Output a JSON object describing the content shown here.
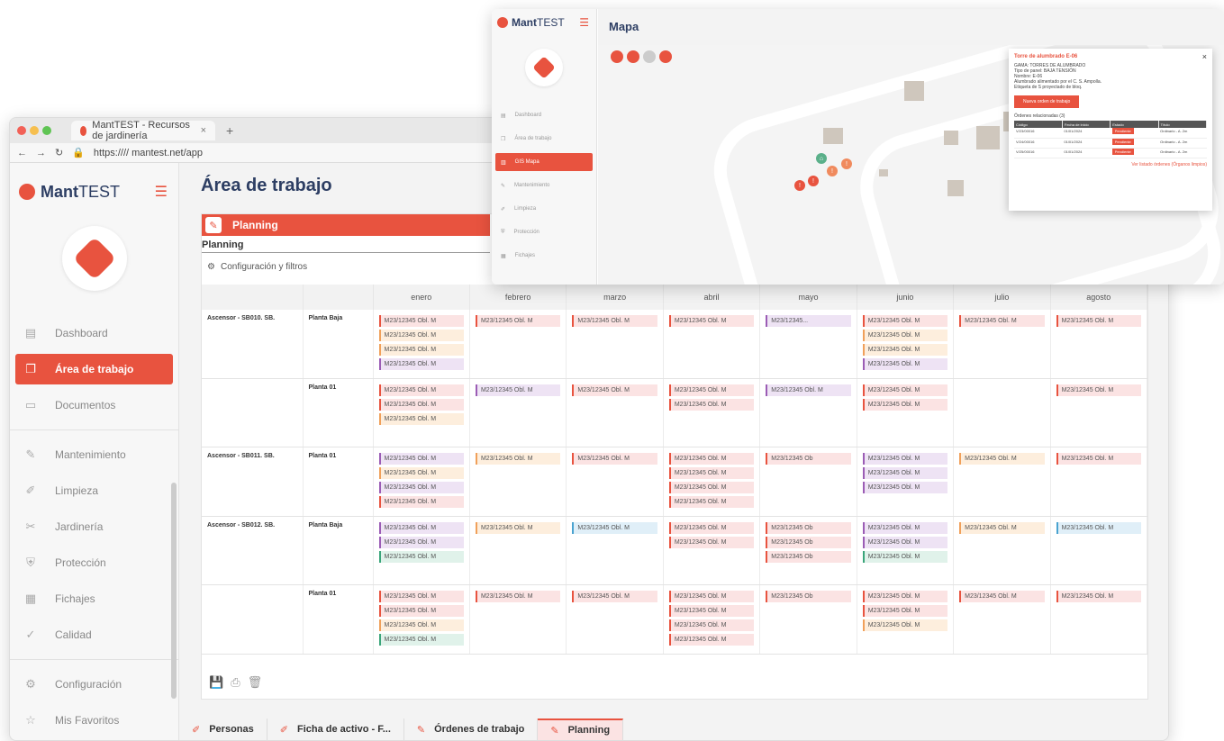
{
  "browser": {
    "tab_title": "MantTEST - Recursos de jardinería",
    "tab_close": "×",
    "new_tab": "+",
    "url": "https://// mantest.net/app"
  },
  "app": {
    "brand_prefix": "Mant",
    "brand_suffix": "TEST",
    "page_title": "Área de trabajo",
    "nav": [
      {
        "label": "Dashboard",
        "icon": "dashboard-icon"
      },
      {
        "label": "Área de trabajo",
        "icon": "workspace-icon",
        "active": true
      },
      {
        "label": "Documentos",
        "icon": "folder-icon"
      },
      {
        "label": "Mantenimiento",
        "icon": "wrench-icon"
      },
      {
        "label": "Limpieza",
        "icon": "broom-icon"
      },
      {
        "label": "Jardinería",
        "icon": "scissors-icon"
      },
      {
        "label": "Protección",
        "icon": "shield-icon"
      },
      {
        "label": "Fichajes",
        "icon": "calendar-icon"
      },
      {
        "label": "Calidad",
        "icon": "check-icon"
      },
      {
        "label": "Configuración",
        "icon": "gear-icon"
      },
      {
        "label": "Mis Favoritos",
        "icon": "star-icon"
      }
    ]
  },
  "planning": {
    "bar_label": "Planning",
    "sub_label": "Planning",
    "config_label": "Configuración y filtros",
    "months": [
      "enero",
      "febrero",
      "marzo",
      "abril",
      "mayo",
      "junio",
      "julio",
      "agosto"
    ],
    "chip_text": "M23/12345 Obl. M",
    "chip_short": "M23/12345 Ob",
    "chip_trunc": "M23/12345...",
    "rows": [
      {
        "asset": "Ascensor - SB010. SB.",
        "plant": "Planta Baja"
      },
      {
        "asset": "",
        "plant": "Planta 01"
      },
      {
        "asset": "Ascensor - SB011. SB.",
        "plant": "Planta 01"
      },
      {
        "asset": "Ascensor - SB012. SB.",
        "plant": "Planta Baja"
      },
      {
        "asset": "",
        "plant": "Planta 01"
      }
    ]
  },
  "bottom_tabs": [
    {
      "label": "Personas"
    },
    {
      "label": "Ficha de activo - F..."
    },
    {
      "label": "Órdenes de trabajo"
    },
    {
      "label": "Planning",
      "active": true
    }
  ],
  "map": {
    "brand_prefix": "Mant",
    "brand_suffix": "TEST",
    "title": "Mapa",
    "nav": [
      "Dashboard",
      "Área de trabajo",
      "GIS Mapa",
      "Mantenimiento",
      "Limpieza",
      "Protección",
      "Fichajes"
    ],
    "popup": {
      "title": "Torre de alumbrado E-06",
      "close": "×",
      "line1": "GAMA: TORRES DE ALUMBRADO",
      "line2": "Tipo de panel: BAJA TENSIÓN",
      "line3": "Nombre: E-06",
      "line4": "Alumbrado alimentado por el C. S. Ampolla.",
      "line5": "Etiqueta de S proyectado de bloq.",
      "button": "Nueva orden de trabajo",
      "related": "Órdenes relacionadas (3)",
      "headers": [
        "Código",
        "Fecha de inicio",
        "Estado",
        "Título"
      ],
      "orders": [
        {
          "code": "V/23/00016",
          "date": "01/01/2024",
          "status": "Pendiente",
          "title": "Ordinario - A. 2m"
        },
        {
          "code": "V/24/00016",
          "date": "01/01/2024",
          "status": "Pendiente",
          "title": "Ordinario - A. 2m"
        },
        {
          "code": "V/25/00016",
          "date": "01/01/2024",
          "status": "Pendiente",
          "title": "Ordinario - A. 2m"
        }
      ],
      "footer_link": "Ver listado órdenes (Órganos limpios)"
    }
  },
  "colors": {
    "accent": "#e8533f",
    "navy": "#2d3e63"
  }
}
